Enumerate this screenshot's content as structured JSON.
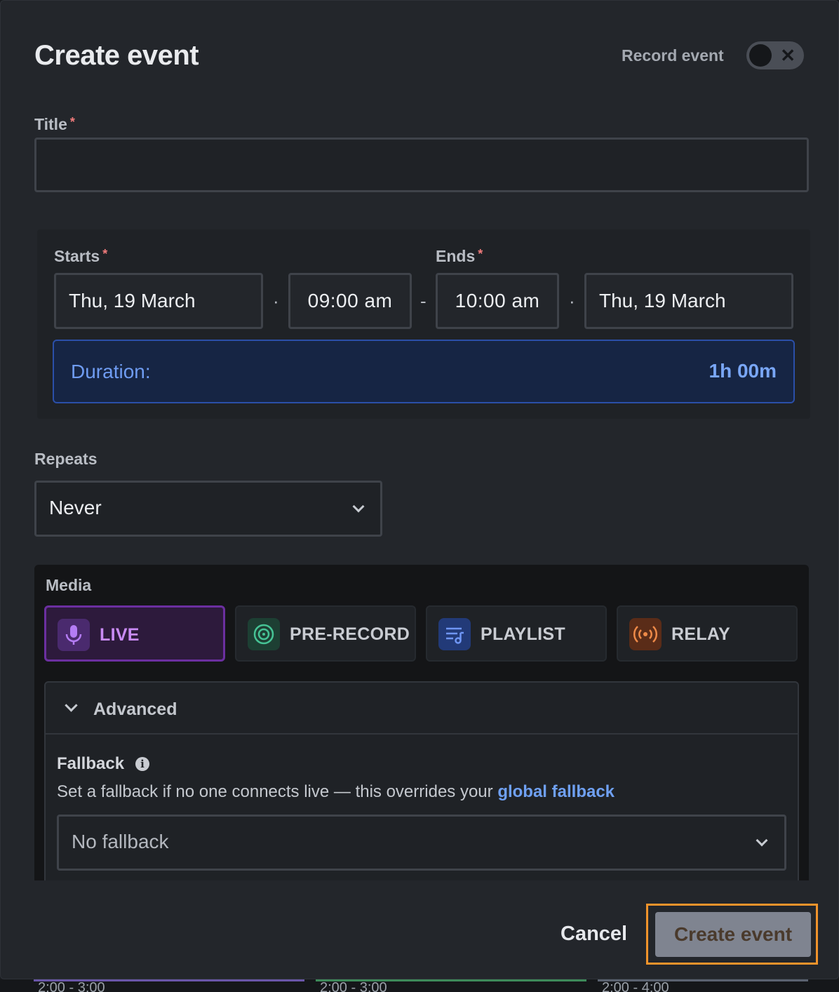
{
  "modal": {
    "title": "Create event",
    "record_label": "Record event",
    "record_toggle_glyph": "✕"
  },
  "title_field": {
    "label": "Title",
    "required_mark": "*",
    "value": ""
  },
  "starts": {
    "label": "Starts",
    "required_mark": "*",
    "date": "Thu, 19 March",
    "time": "09:00 am"
  },
  "ends": {
    "label": "Ends",
    "required_mark": "*",
    "time": "10:00 am",
    "date": "Thu, 19 March"
  },
  "separators": {
    "dot": "·",
    "dash": "-"
  },
  "duration": {
    "label": "Duration:",
    "value": "1h 00m"
  },
  "repeats": {
    "label": "Repeats",
    "value": "Never"
  },
  "media": {
    "label": "Media",
    "options": [
      {
        "label": "LIVE",
        "icon": "microphone-icon",
        "selected": true,
        "color": "#a56cf0"
      },
      {
        "label": "PRE-RECORD",
        "icon": "vinyl-icon",
        "selected": false,
        "color": "#3fb58a"
      },
      {
        "label": "PLAYLIST",
        "icon": "playlist-icon",
        "selected": false,
        "color": "#5b82f0"
      },
      {
        "label": "RELAY",
        "icon": "broadcast-icon",
        "selected": false,
        "color": "#e57a3a"
      }
    ]
  },
  "advanced": {
    "header": "Advanced",
    "fallback_label": "Fallback",
    "info_glyph": "i",
    "fallback_desc": "Set a fallback if no one connects live — this overrides your ",
    "fallback_link": "global fallback",
    "fallback_value": "No fallback"
  },
  "footer": {
    "cancel": "Cancel",
    "create": "Create event"
  },
  "background_strip": [
    "2:00 - 3:00",
    "2:00 - 3:00",
    "2:00 - 4:00"
  ]
}
